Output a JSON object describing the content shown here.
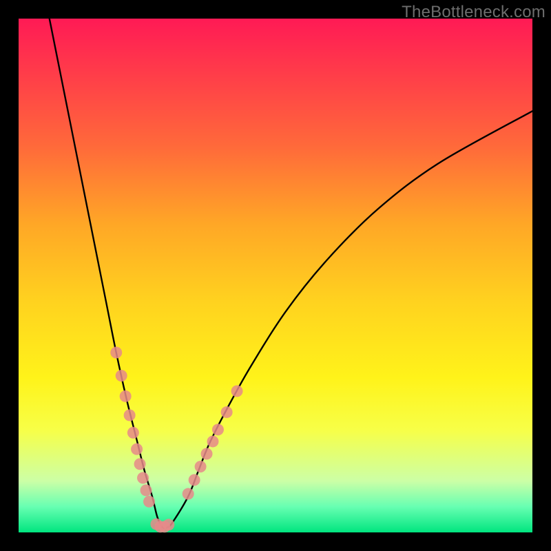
{
  "watermark": "TheBottleneck.com",
  "chart_data": {
    "type": "line",
    "title": "",
    "xlabel": "",
    "ylabel": "",
    "xlim": [
      0,
      100
    ],
    "ylim": [
      0,
      100
    ],
    "grid": false,
    "series": [
      {
        "name": "bottleneck-curve",
        "x": [
          6,
          10,
          14,
          17,
          19,
          21,
          23,
          24.5,
          26,
          27,
          28,
          29,
          30,
          33,
          35,
          37,
          40,
          45,
          52,
          60,
          70,
          82,
          100
        ],
        "y": [
          100,
          80,
          60,
          45,
          35,
          26,
          18,
          12,
          7,
          3,
          1,
          1,
          2,
          7,
          12,
          17,
          23,
          32,
          43,
          53,
          63,
          72,
          82
        ]
      }
    ],
    "markers": [
      {
        "name": "left-cluster",
        "x": [
          19.0,
          20.0,
          20.8,
          21.6,
          22.3,
          23.0,
          23.6,
          24.2,
          24.8,
          25.4
        ],
        "y": [
          35.0,
          30.5,
          26.5,
          22.8,
          19.4,
          16.2,
          13.3,
          10.6,
          8.2,
          6.0
        ]
      },
      {
        "name": "trough",
        "x": [
          26.8,
          27.6,
          28.4,
          29.2
        ],
        "y": [
          1.6,
          1.1,
          1.1,
          1.5
        ]
      },
      {
        "name": "right-cluster",
        "x": [
          33.0,
          34.2,
          35.4,
          36.6,
          37.8,
          38.8,
          40.5,
          42.5
        ],
        "y": [
          7.5,
          10.2,
          12.8,
          15.3,
          17.7,
          20.0,
          23.4,
          27.5
        ]
      }
    ]
  }
}
